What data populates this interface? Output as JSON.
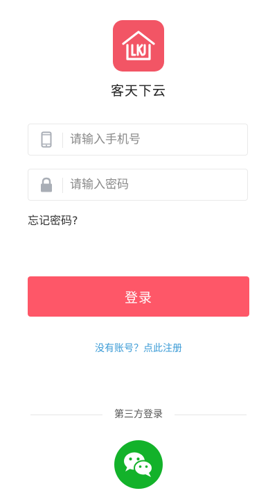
{
  "app": {
    "name": "客天下云",
    "logo_letters": "LKJ",
    "brand_color": "#f25565"
  },
  "form": {
    "phone": {
      "icon": "phone-icon",
      "placeholder": "请输入手机号",
      "value": ""
    },
    "password": {
      "icon": "lock-icon",
      "placeholder": "请输入密码",
      "value": ""
    },
    "forgot_label": "忘记密码?"
  },
  "actions": {
    "login_label": "登录",
    "login_color": "#fe5768",
    "register_label": "没有账号？点此注册",
    "link_color": "#3b9bd6"
  },
  "third_party": {
    "label": "第三方登录",
    "providers": [
      {
        "name": "wechat",
        "icon": "wechat-icon",
        "color": "#13b22a"
      }
    ]
  }
}
